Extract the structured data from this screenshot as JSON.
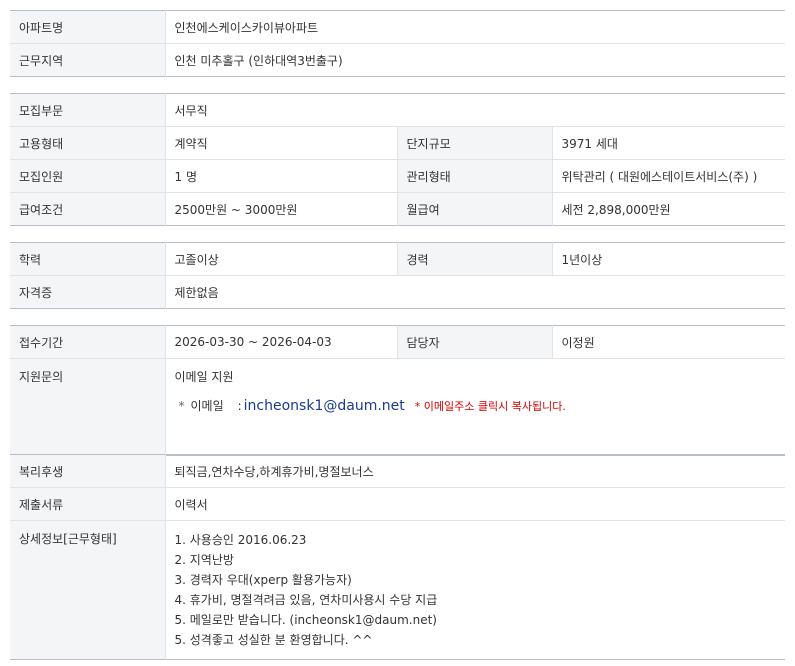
{
  "apt": {
    "name_label": "아파트명",
    "name_value": "인천에스케이스카이뷰아파트",
    "region_label": "근무지역",
    "region_value": "인천  미추홀구 (인하대역3번출구)"
  },
  "job": {
    "dept_label": "모집부문",
    "dept_value": "서무직",
    "type_label": "고용형태",
    "type_value": "계약직",
    "size_label": "단지규모",
    "size_value": "3971 세대",
    "count_label": "모집인원",
    "count_value": "1 명",
    "mgmt_label": "관리형태",
    "mgmt_value": "위탁관리 ( 대원에스테이트서비스(주) )",
    "salary_label": "급여조건",
    "salary_value": "2500만원 ~ 3000만원",
    "monthly_label": "월급여",
    "monthly_value": "세전 2,898,000만원"
  },
  "qual": {
    "edu_label": "학력",
    "edu_value": "고졸이상",
    "exp_label": "경력",
    "exp_value": "1년이상",
    "cert_label": "자격증",
    "cert_value": "제한없음"
  },
  "apply": {
    "period_label": "접수기간",
    "period_value": "2026-03-30 ~ 2026-04-03",
    "manager_label": "담당자",
    "manager_value": "이정원",
    "inquiry_label": "지원문의",
    "inquiry_value": "이메일 지원",
    "email_bullet": "*",
    "email_label": "이메일",
    "email_colon": ":",
    "email_value": "incheonsk1@daum.net",
    "email_note": "* 이메일주소 클릭시 복사됩니다."
  },
  "extra": {
    "welfare_label": "복리후생",
    "welfare_value": "퇴직금,연차수당,하계휴가비,명절보너스",
    "docs_label": "제출서류",
    "docs_value": "이력서",
    "detail_label": "상세정보[근무형태]",
    "detail_lines": [
      "1. 사용승인 2016.06.23",
      "2. 지역난방",
      "3. 경력자 우대(xperp 활용가능자)",
      "4. 휴가비, 명절격려금 있음, 연차미사용시 수당 지급",
      "5. 메일로만 받습니다. (incheonsk1@daum.net)",
      "5. 성격좋고 성실한 분 환영합니다. ^^"
    ]
  }
}
